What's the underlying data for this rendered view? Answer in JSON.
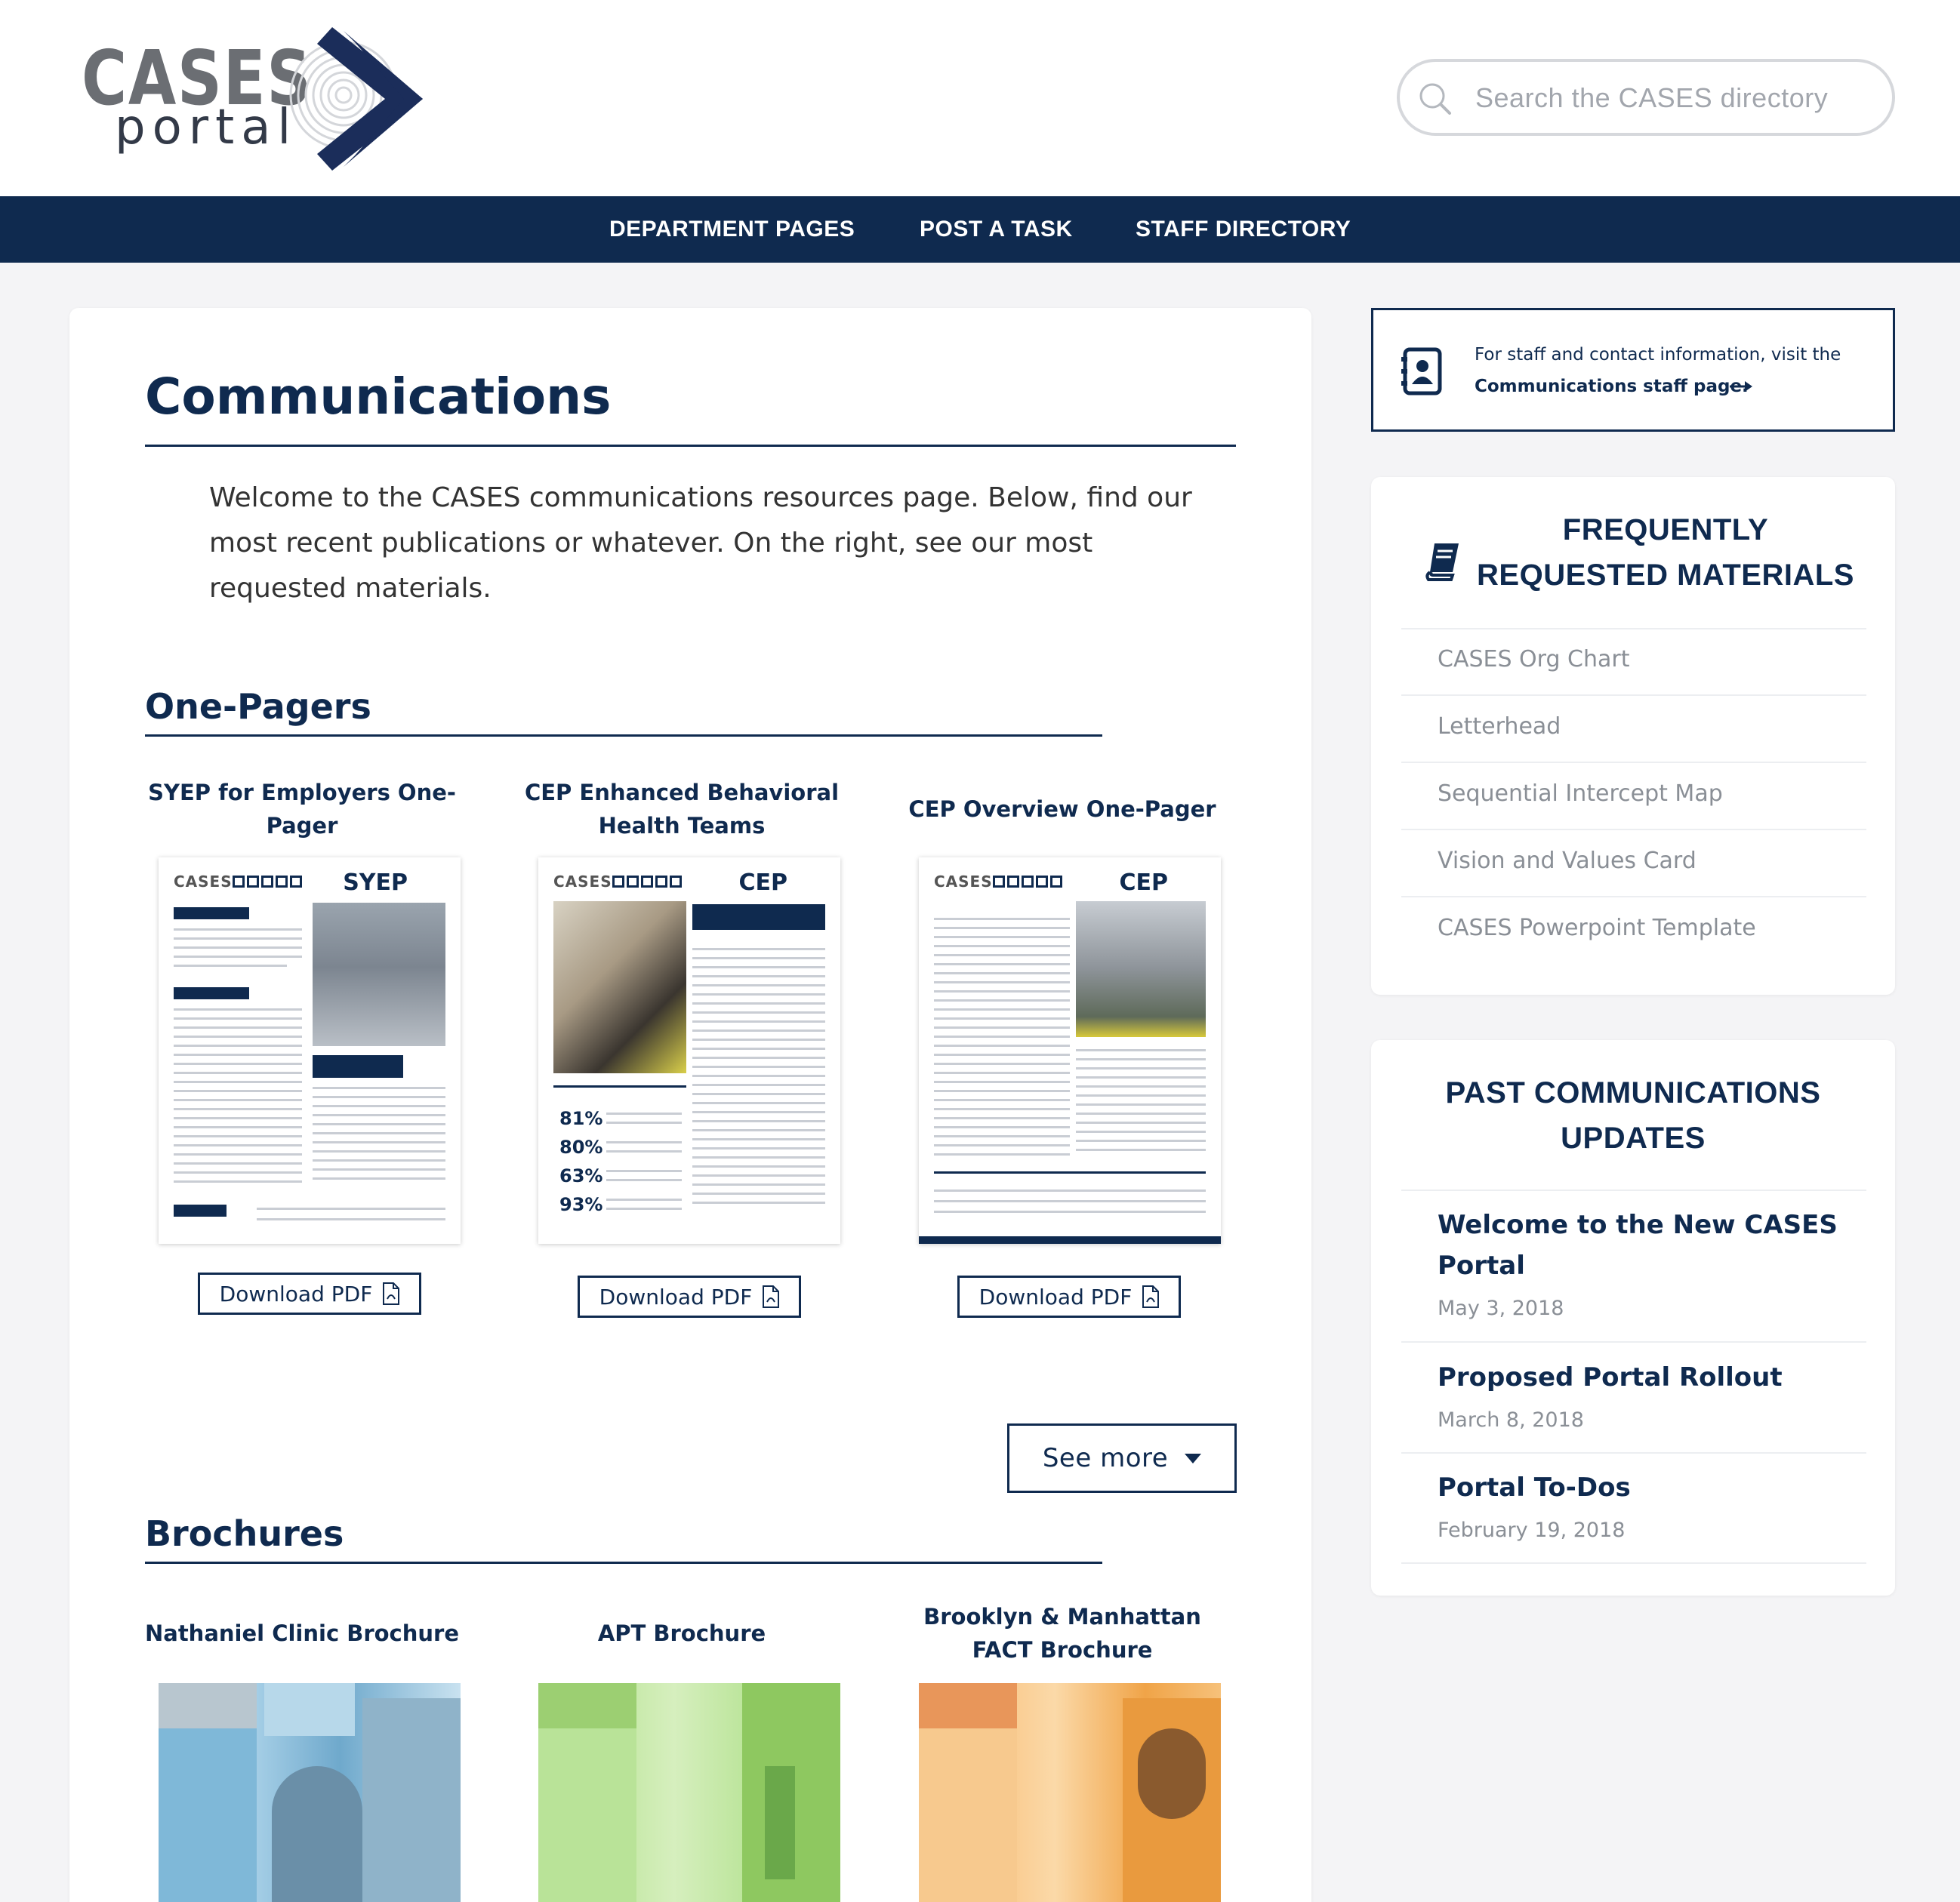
{
  "logo": {
    "name": "CASES",
    "sub": "portal"
  },
  "search": {
    "placeholder": "Search the CASES directory"
  },
  "nav": {
    "items": [
      "DEPARTMENT PAGES",
      "POST A TASK",
      "STAFF DIRECTORY"
    ]
  },
  "page": {
    "title": "Communications",
    "intro": "Welcome to the CASES communications resources page. Below, find our most recent publications or whatever. On the right, see our most requested materials."
  },
  "one_pagers": {
    "heading": "One-Pagers",
    "items": [
      {
        "title": "SYEP for Employers One-Pager",
        "code": "SYEP",
        "download_label": "Download PDF"
      },
      {
        "title": "CEP Enhanced Behavioral Health Teams",
        "code": "CEP",
        "download_label": "Download PDF"
      },
      {
        "title": "CEP Overview One-Pager",
        "code": "CEP",
        "download_label": "Download PDF"
      }
    ],
    "thumb_brand": "CASES",
    "thumb_stats": [
      "81%",
      "80%",
      "63%",
      "93%"
    ]
  },
  "see_more": {
    "label": "See more"
  },
  "brochures": {
    "heading": "Brochures",
    "items": [
      {
        "title": "Nathaniel Clinic Brochure",
        "tint": "#5aa6cf"
      },
      {
        "title": "APT Brochure",
        "tint": "#8ccc5a"
      },
      {
        "title": "Brooklyn & Manhattan FACT Brochure",
        "tint": "#f0a040"
      }
    ]
  },
  "staff_info": {
    "text": "For staff and contact information, visit the",
    "link": "Communications staff page."
  },
  "frequently_requested": {
    "title_line1": "FREQUENTLY",
    "title_line2": "REQUESTED MATERIALS",
    "items": [
      "CASES Org Chart",
      "Letterhead",
      "Sequential Intercept Map",
      "Vision and Values Card",
      "CASES Powerpoint Template"
    ]
  },
  "past_updates": {
    "title_line1": "PAST COMMUNICATIONS",
    "title_line2": "UPDATES",
    "items": [
      {
        "title": "Welcome to the New CASES Portal",
        "date": "May 3, 2018"
      },
      {
        "title": "Proposed Portal Rollout",
        "date": "March 8, 2018"
      },
      {
        "title": "Portal To-Dos",
        "date": "February 19, 2018"
      }
    ]
  },
  "colors": {
    "navy": "#0f2a4f",
    "page_bg": "#f4f4f6",
    "muted_text": "#8a8f96"
  },
  "icons": {
    "search": "search-icon",
    "pdf": "pdf-file-icon",
    "contact": "contact-card-icon",
    "arrow": "arrow-right-icon",
    "book": "book-icon",
    "caret": "caret-down-icon"
  }
}
